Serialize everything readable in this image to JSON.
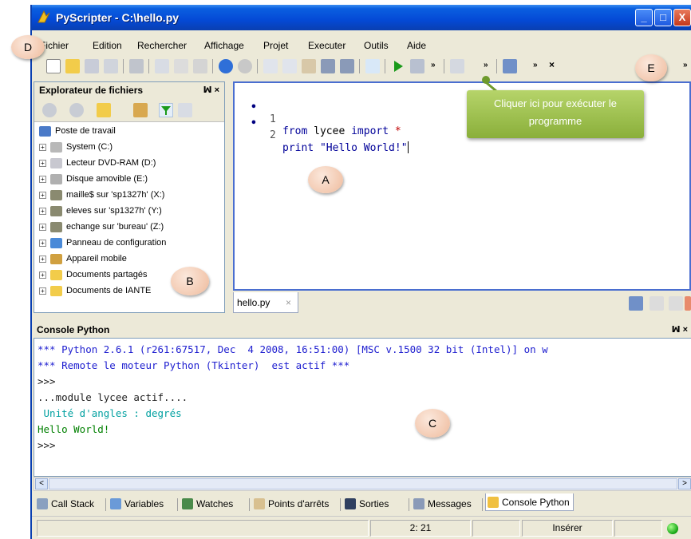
{
  "window": {
    "title": "PyScripter - C:\\hello.py",
    "controls": {
      "minimize": "_",
      "maximize": "□",
      "close": "X"
    }
  },
  "menu": {
    "items": [
      "Fichier",
      "Edition",
      "Rechercher",
      "Affichage",
      "Projet",
      "Executer",
      "Outils",
      "Aide"
    ]
  },
  "toolbar": {
    "overflow": "»",
    "close": "×"
  },
  "explorer": {
    "title": "Explorateur de fichiers",
    "pin": "ꟽ ×",
    "items": [
      {
        "label": "Poste de travail",
        "icon": "computer-icon",
        "expander": false
      },
      {
        "label": "System (C:)",
        "icon": "hard-drive-icon",
        "expander": true
      },
      {
        "label": "Lecteur DVD-RAM (D:)",
        "icon": "dvd-drive-icon",
        "expander": true
      },
      {
        "label": "Disque amovible (E:)",
        "icon": "removable-disk-icon",
        "expander": true
      },
      {
        "label": "maille$ sur 'sp1327h' (X:)",
        "icon": "network-drive-icon",
        "expander": true
      },
      {
        "label": "eleves sur 'sp1327h' (Y:)",
        "icon": "network-drive-icon",
        "expander": true
      },
      {
        "label": "echange sur 'bureau' (Z:)",
        "icon": "network-drive-icon",
        "expander": true
      },
      {
        "label": "Panneau de configuration",
        "icon": "control-panel-icon",
        "expander": true
      },
      {
        "label": "Appareil mobile",
        "icon": "mobile-device-icon",
        "expander": true
      },
      {
        "label": "Documents partagés",
        "icon": "folder-icon",
        "expander": true
      },
      {
        "label": "Documents de IANTE",
        "icon": "folder-icon",
        "expander": true
      }
    ]
  },
  "editor": {
    "lines": [
      {
        "num": "1",
        "kw1": "from",
        "mid": " lycee ",
        "kw2": "import",
        "op": " *",
        "str": ""
      },
      {
        "num": "2",
        "kw1": "print",
        "mid": " ",
        "kw2": "",
        "op": "",
        "str": "\"Hello World!\""
      }
    ],
    "tab": {
      "label": "hello.py",
      "close": "×"
    }
  },
  "console": {
    "title": "Console Python",
    "pin": "ꟽ ×",
    "lines": [
      {
        "text": "*** Python 2.6.1 (r261:67517, Dec  4 2008, 16:51:00) [MSC v.1500 32 bit (Intel)] on w",
        "color": "blue"
      },
      {
        "text": "*** Remote le moteur Python (Tkinter)  est actif ***",
        "color": "blue"
      },
      {
        "text": ">>>",
        "color": "black"
      },
      {
        "text": "...module lycee actif....",
        "color": "black"
      },
      {
        "text": " Unité d'angles : degrés",
        "color": "teal"
      },
      {
        "text": "Hello World!",
        "color": "green"
      },
      {
        "text": ">>>",
        "color": "black"
      }
    ]
  },
  "scrollbar": {
    "left": "<",
    "right": ">"
  },
  "bottom_tabs": [
    {
      "label": "Call Stack",
      "icon": "call-stack-icon"
    },
    {
      "label": "Variables",
      "icon": "variables-icon"
    },
    {
      "label": "Watches",
      "icon": "watches-icon"
    },
    {
      "label": "Points d'arrêts",
      "icon": "breakpoint-hand-icon"
    },
    {
      "label": "Sorties",
      "icon": "output-icon"
    },
    {
      "label": "Messages",
      "icon": "messages-icon"
    },
    {
      "label": "Console Python",
      "icon": "python-console-icon"
    }
  ],
  "status": {
    "position": "2: 21",
    "mode": "Insérer"
  },
  "annotations": {
    "A": "A",
    "B": "B",
    "C": "C",
    "D": "D",
    "E": "E",
    "tooltip": "Cliquer ici pour exécuter le programme"
  },
  "colors": {
    "title_blue": "#0449d6",
    "keyword": "#000099",
    "operator": "#c00000",
    "console_blue": "#2020d0",
    "console_teal": "#00a0a0",
    "console_green": "#008000",
    "callout": "#f2c6ac",
    "tooltip": "#8aaf3a",
    "run_green": "#1a9a1a"
  }
}
